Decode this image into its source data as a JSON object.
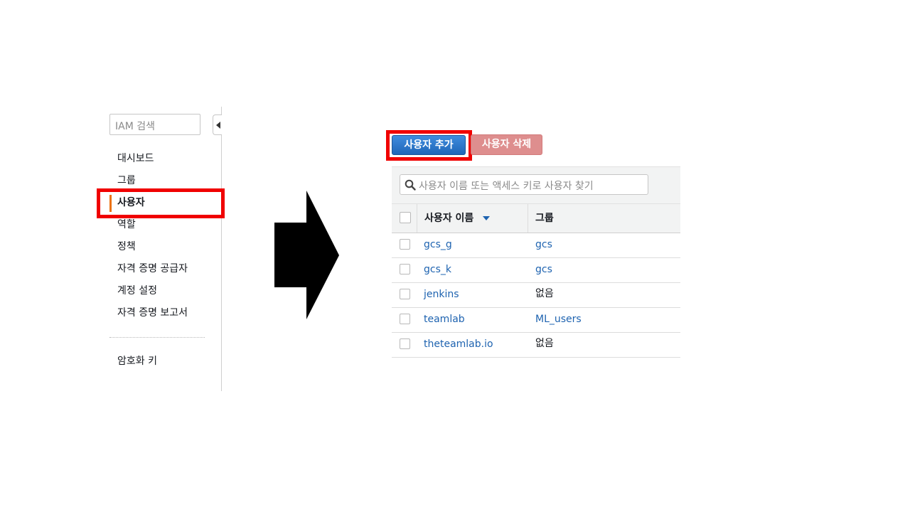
{
  "sidebar": {
    "search_placeholder": "IAM 검색",
    "items": [
      {
        "label": "대시보드"
      },
      {
        "label": "그룹"
      },
      {
        "label": "사용자"
      },
      {
        "label": "역할"
      },
      {
        "label": "정책"
      },
      {
        "label": "자격 증명 공급자"
      },
      {
        "label": "계정 설정"
      },
      {
        "label": "자격 증명 보고서"
      }
    ],
    "active_item": "사용자",
    "extra_items": [
      {
        "label": "암호화 키"
      }
    ]
  },
  "toolbar": {
    "add_user_label": "사용자 추가",
    "delete_user_label": "사용자 삭제",
    "filter_placeholder": "사용자 이름 또는 액세스 키로 사용자 찾기"
  },
  "table": {
    "columns": [
      {
        "label": "사용자 이름",
        "sorted": "descending"
      },
      {
        "label": "그룹"
      }
    ],
    "rows": [
      {
        "user": "gcs_g",
        "group": "gcs",
        "group_is_link": true
      },
      {
        "user": "gcs_k",
        "group": "gcs",
        "group_is_link": true
      },
      {
        "user": "jenkins",
        "group": "없음",
        "group_is_link": false
      },
      {
        "user": "teamlab",
        "group": "ML_users",
        "group_is_link": true
      },
      {
        "user": "theteamlab.io",
        "group": "없음",
        "group_is_link": false
      }
    ]
  },
  "colors": {
    "highlight": "#f00000",
    "primary_button": "#2a73c9",
    "danger_button": "#de8e8e",
    "active_accent": "#ec7211",
    "link": "#1e63b0"
  }
}
